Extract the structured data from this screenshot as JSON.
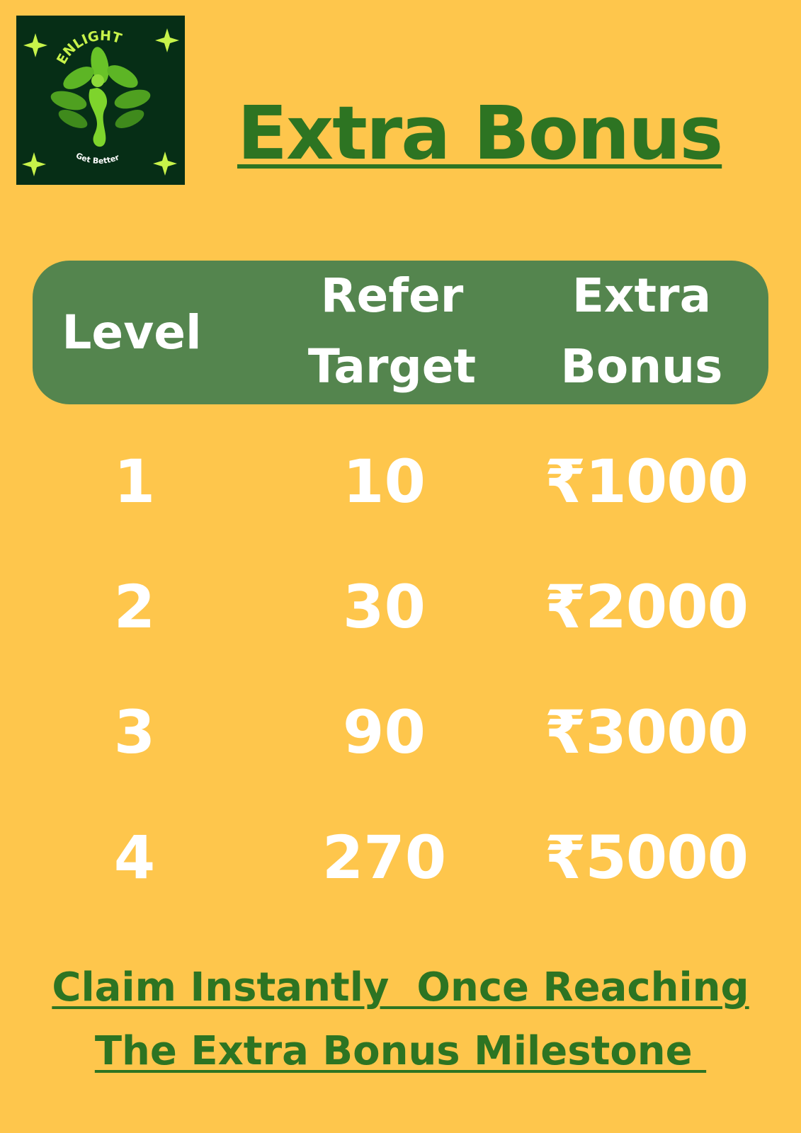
{
  "logo": {
    "brand_text": "ENLIGHT",
    "tagline": "Get Better",
    "icon": "leaf-figure-icon",
    "colors": {
      "background": "#062E16",
      "leaf": "#7ED42C",
      "text": "#C7F34A"
    }
  },
  "title": "Extra Bonus",
  "table": {
    "headers": {
      "level": "Level",
      "refer_target_line1": "Refer",
      "refer_target_line2": "Target",
      "extra_bonus_line1": "Extra",
      "extra_bonus_line2": "Bonus"
    },
    "rows": [
      {
        "level": "1",
        "refer_target": "10",
        "extra_bonus": "₹1000"
      },
      {
        "level": "2",
        "refer_target": "30",
        "extra_bonus": "₹2000"
      },
      {
        "level": "3",
        "refer_target": "90",
        "extra_bonus": "₹3000"
      },
      {
        "level": "4",
        "refer_target": "270",
        "extra_bonus": "₹5000"
      }
    ]
  },
  "footer": {
    "line1": "Claim Instantly  Once Reaching",
    "line2": "The Extra Bonus Milestone "
  },
  "colors": {
    "background": "#FEC64C",
    "header_band": "#54854E",
    "accent_green": "#2D7422",
    "cell_text": "#FFFFFF"
  }
}
